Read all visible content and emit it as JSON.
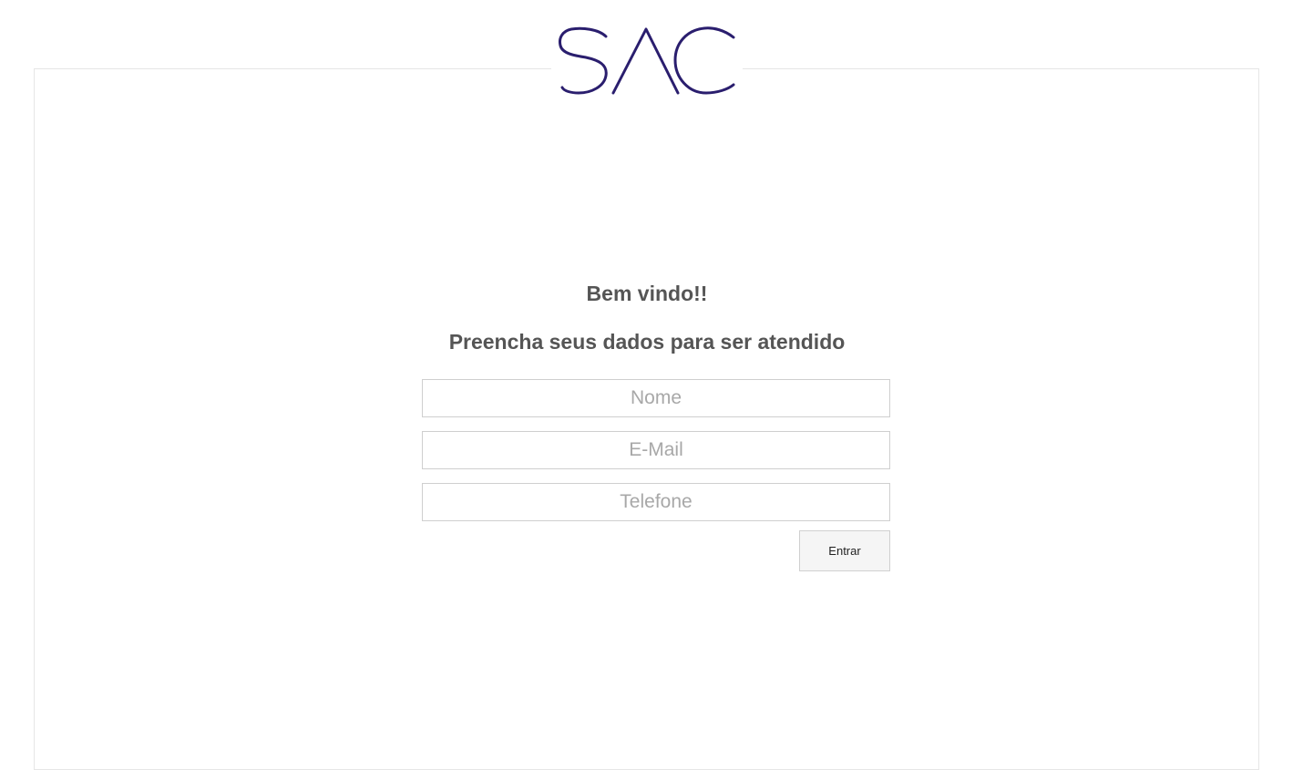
{
  "logo": {
    "text": "SAC",
    "color": "#2a1e6e"
  },
  "welcome": {
    "title": "Bem vindo!!",
    "subtitle": "Preencha seus dados para ser atendido"
  },
  "form": {
    "name_placeholder": "Nome",
    "email_placeholder": "E-Mail",
    "phone_placeholder": "Telefone",
    "submit_label": "Entrar"
  }
}
